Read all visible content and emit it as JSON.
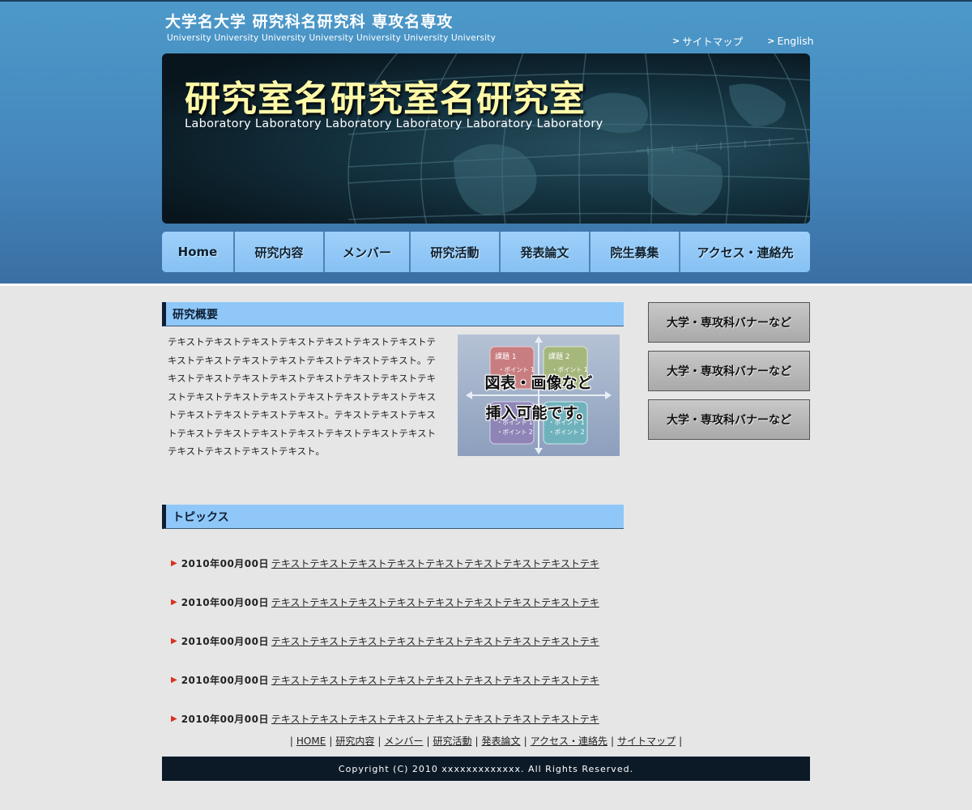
{
  "header": {
    "university": "大学名大学 研究科名研究科 専攻名専攻",
    "university_en": "University University University University University University University",
    "links": [
      {
        "caret": ">",
        "label": "サイトマップ"
      },
      {
        "caret": ">",
        "label": "English"
      }
    ]
  },
  "hero": {
    "title": "研究室名研究室名研究室",
    "subtitle": "Laboratory Laboratory  Laboratory Laboratory Laboratory Laboratory"
  },
  "nav": [
    "Home",
    "研究内容",
    "メンバー",
    "研究活動",
    "発表論文",
    "院生募集",
    "アクセス・連絡先"
  ],
  "overview": {
    "heading": "研究概要",
    "text": "テキストテキストテキストテキストテキストテキストテキストテキストテキストテキストテキストテキストテキストテキスト。テキストテキストテキストテキストテキストテキストテキストテキストテキストテキストテキストテキストテキストテキストテキストテキストテキストテキストテキスト。テキストテキストテキストテキストテキストテキストテキストテキストテキストテキストテキストテキストテキストテキスト。",
    "figure": {
      "caption_line1": "図表・画像など",
      "caption_line2": "挿入可能です。",
      "box1": "課題 1",
      "box2": "課題 2",
      "point1": "・ポイント 1",
      "point2": "・ポイント 2"
    }
  },
  "topics": {
    "heading": "トピックス",
    "items": [
      {
        "date": "2010年00月00日",
        "text": "テキストテキストテキストテキストテキストテキストテキストテキストテキ"
      },
      {
        "date": "2010年00月00日",
        "text": "テキストテキストテキストテキストテキストテキストテキストテキストテキ"
      },
      {
        "date": "2010年00月00日",
        "text": "テキストテキストテキストテキストテキストテキストテキストテキストテキ"
      },
      {
        "date": "2010年00月00日",
        "text": "テキストテキストテキストテキストテキストテキストテキストテキストテキ"
      },
      {
        "date": "2010年00月00日",
        "text": "テキストテキストテキストテキストテキストテキストテキストテキストテキ"
      }
    ]
  },
  "sidebar": {
    "banners": [
      "大学・専攻科バナーなど",
      "大学・専攻科バナーなど",
      "大学・専攻科バナーなど"
    ]
  },
  "footer": {
    "separator": "|",
    "links": [
      "HOME",
      "研究内容",
      "メンバー",
      "研究活動",
      "発表論文",
      "アクセス・連絡先",
      "サイトマップ"
    ],
    "copyright": "Copyright (C) 2010 xxxxxxxxxxxxx. All Rights Reserved."
  },
  "colors": {
    "header_bg": "#4587bd",
    "nav_bg": "#8fc8f8",
    "hero_title": "#fff9a8",
    "copyright_bg": "#0c1a28",
    "topic_arrow": "#d8321e"
  },
  "icons": {
    "util_link": "caret-right-icon",
    "topic": "triangle-right-icon"
  }
}
